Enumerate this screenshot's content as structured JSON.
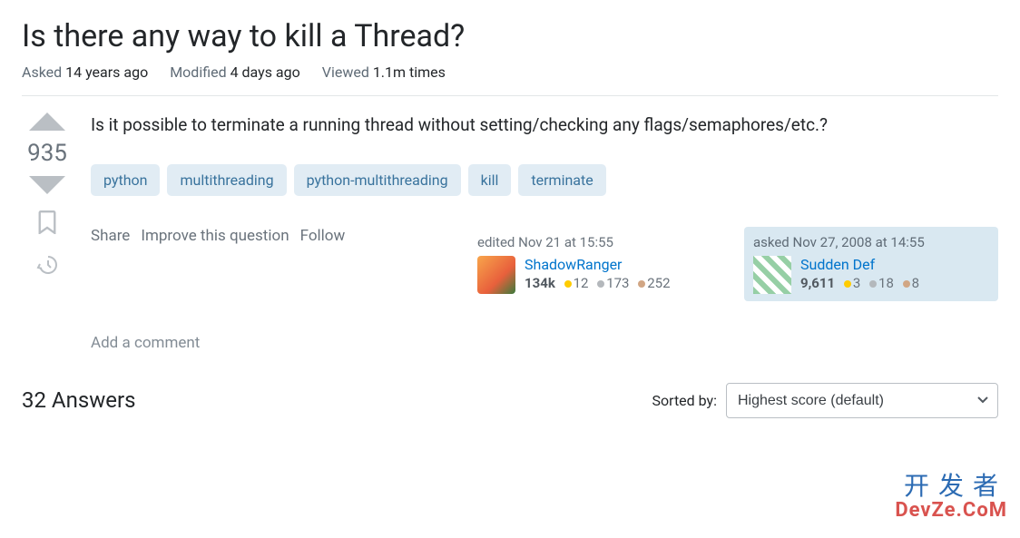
{
  "title": "Is there any way to kill a Thread?",
  "meta": {
    "asked_label": "Asked",
    "asked_value": "14 years ago",
    "modified_label": "Modified",
    "modified_value": "4 days ago",
    "viewed_label": "Viewed",
    "viewed_value": "1.1m times"
  },
  "vote_score": "935",
  "question_text": "Is it possible to terminate a running thread without setting/checking any flags/semaphores/etc.?",
  "tags": [
    "python",
    "multithreading",
    "python-multithreading",
    "kill",
    "terminate"
  ],
  "actions": {
    "share": "Share",
    "improve": "Improve this question",
    "follow": "Follow"
  },
  "editor": {
    "date_prefix": "edited",
    "date": "Nov 21 at 15:55",
    "name": "ShadowRanger",
    "rep": "134k",
    "gold": "12",
    "silver": "173",
    "bronze": "252"
  },
  "asker": {
    "date_prefix": "asked",
    "date": "Nov 27, 2008 at 14:55",
    "name": "Sudden Def",
    "rep": "9,611",
    "gold": "3",
    "silver": "18",
    "bronze": "8"
  },
  "add_comment": "Add a comment",
  "answers": {
    "count_label": "32 Answers",
    "sorted_by_label": "Sorted by:",
    "selected": "Highest score (default)"
  },
  "watermark": {
    "cn": "开发者",
    "en": "DevZe.CoM"
  }
}
